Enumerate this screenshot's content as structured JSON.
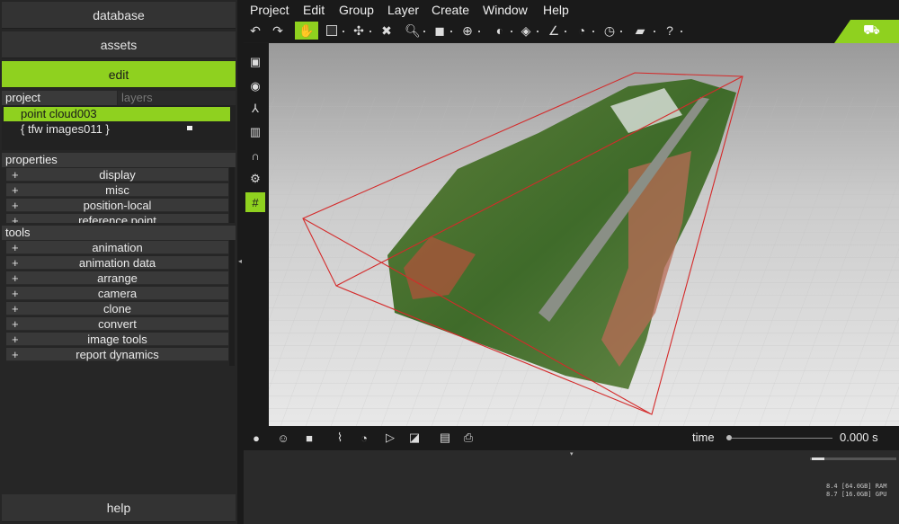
{
  "nav": {
    "database": "database",
    "assets": "assets",
    "edit": "edit",
    "help": "help"
  },
  "panel_tabs": {
    "project": "project",
    "layers": "layers"
  },
  "tree": [
    {
      "label": "point cloud003"
    },
    {
      "label": "{ tfw images011 }"
    }
  ],
  "properties": {
    "header": "properties",
    "items": [
      "display",
      "misc",
      "position-local",
      "reference point"
    ]
  },
  "tools": {
    "header": "tools",
    "items": [
      "animation",
      "animation data",
      "arrange",
      "camera",
      "clone",
      "convert",
      "image tools",
      "report dynamics"
    ]
  },
  "plus": "+",
  "menu": [
    "Project",
    "Edit",
    "Group",
    "Layer",
    "Create",
    "Window",
    "Help"
  ],
  "timeline": {
    "label": "time",
    "value": "0.000 s"
  },
  "memory": {
    "ram": "8.4 [64.0GB] RAM",
    "gpu": "8.7 [16.0GB] GPU"
  },
  "colors": {
    "accent": "#8fd11f",
    "bbox": "#d42a2a"
  },
  "icons": [
    "undo-icon",
    "redo-icon",
    "hand-icon",
    "select-icon",
    "move-icon",
    "delete-icon",
    "zoom-icon",
    "cube-icon",
    "gizmo-icon",
    "angle-icon",
    "measure-icon"
  ]
}
